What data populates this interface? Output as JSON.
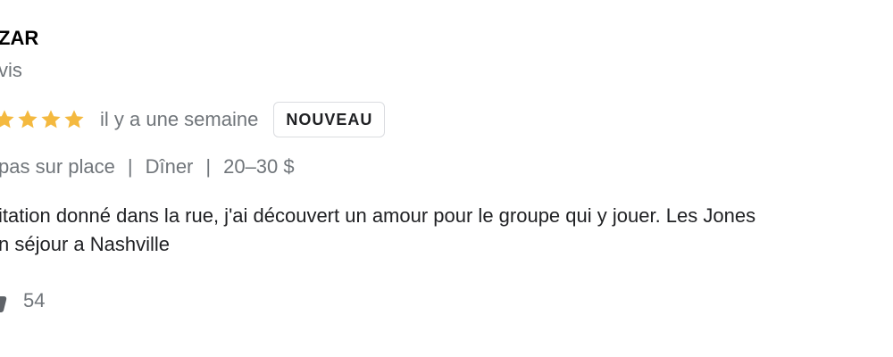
{
  "review": {
    "author_name": "ZAR",
    "author_meta": "vis",
    "rating": 5,
    "rating_max": 5,
    "date": "il y a une semaine",
    "badge": "NOUVEAU",
    "details": {
      "service": "pas sur place",
      "separator": "|",
      "meal": "Dîner",
      "price": "20–30 $"
    },
    "text_lines": [
      "itation donné dans la rue, j'ai découvert un amour pour le groupe qui y jouer. Les Jones",
      "n séjour a Nashville"
    ],
    "likes": "54"
  },
  "colors": {
    "star": "#f4b93f",
    "muted_text": "#70757a",
    "body_text": "#202124",
    "badge_border": "#dadce0"
  },
  "icons": {
    "star": "star-icon",
    "like": "thumbs-up-icon"
  }
}
